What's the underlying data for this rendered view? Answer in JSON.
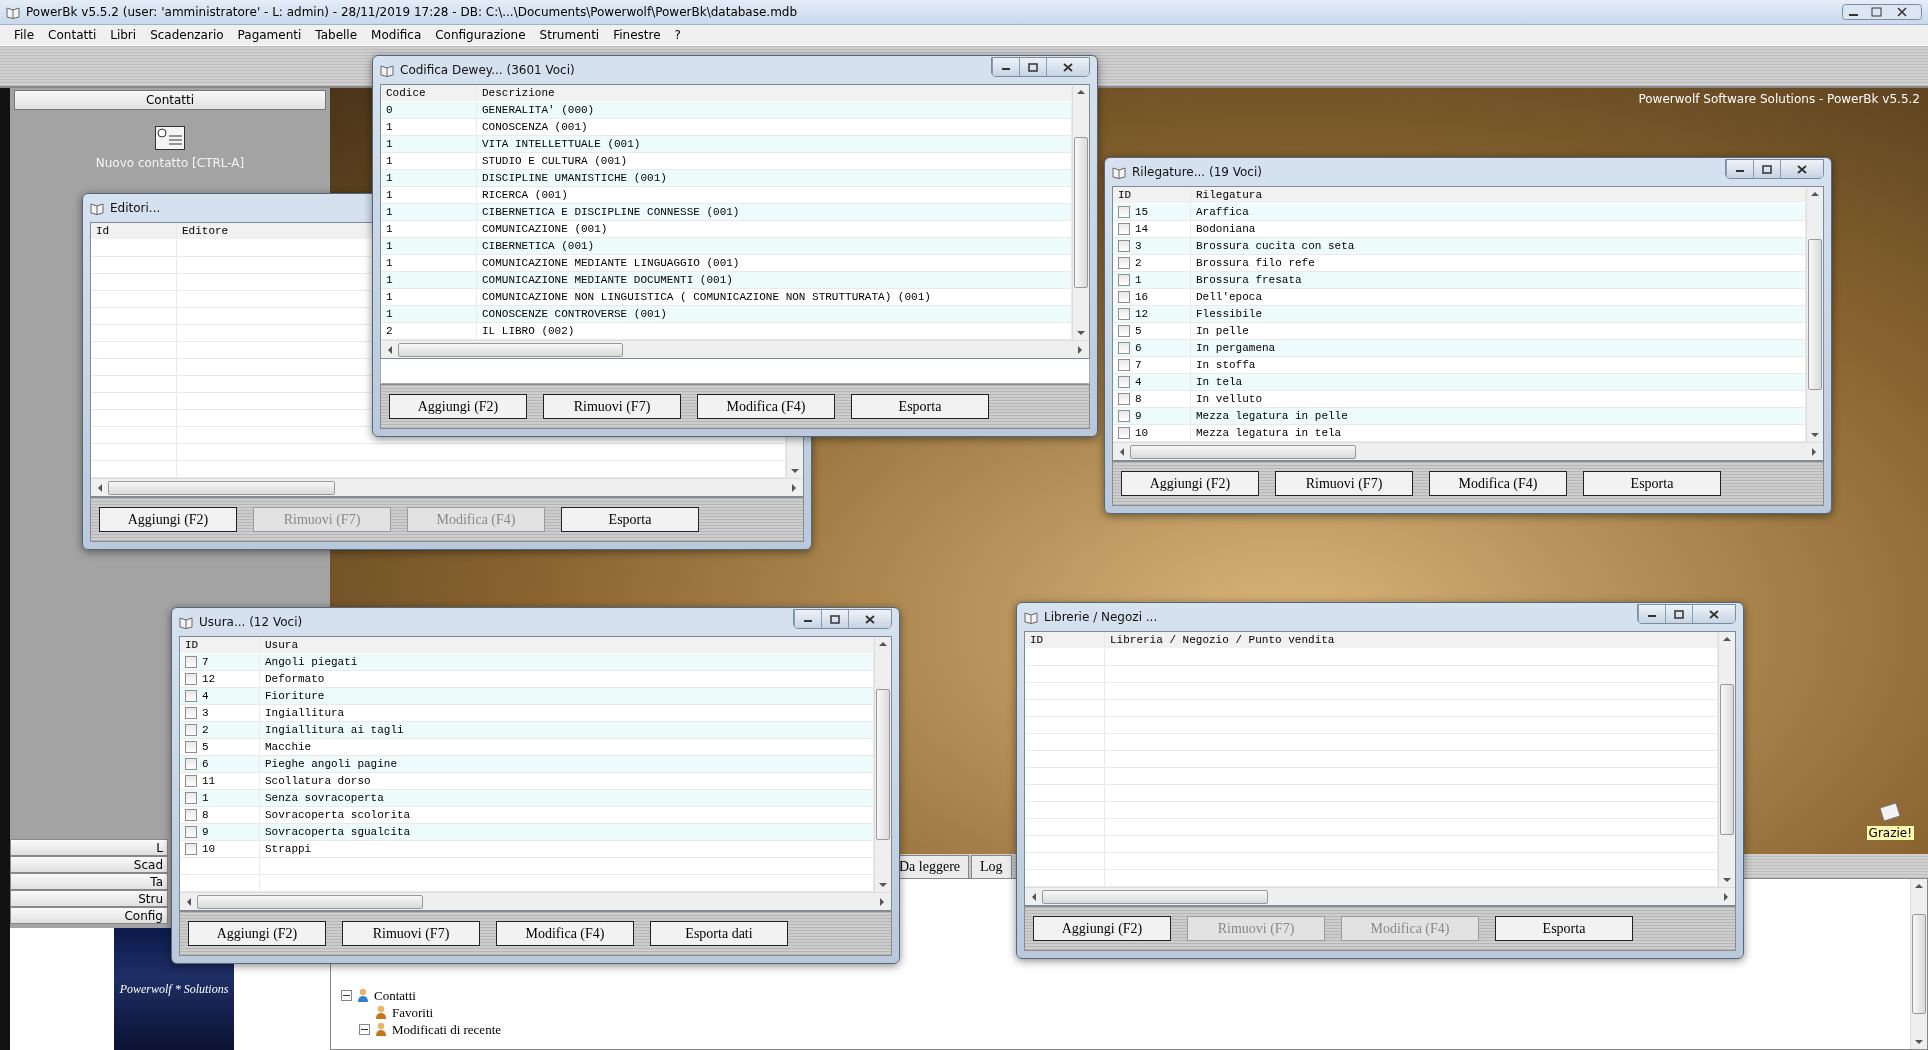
{
  "app_window": {
    "title": "PowerBk v5.5.2  (user: 'amministratore'  - L: admin) - 28/11/2019 17:28 - DB: C:\\...\\Documents\\Powerwolf\\PowerBk\\database.mdb"
  },
  "menu": [
    "File",
    "Contatti",
    "Libri",
    "Scadenzario",
    "Pagamenti",
    "Tabelle",
    "Modifica",
    "Configurazione",
    "Strumenti",
    "Finestre",
    "?"
  ],
  "sidebar": {
    "header": "Contatti",
    "action": "Nuovo contatto [CTRL-A]",
    "buttons": [
      "L",
      "Scad",
      "Ta",
      "Stru",
      "Config"
    ],
    "logo": "Powerwolf * Solutions"
  },
  "background": {
    "caption": "Powerwolf Software Solutions - PowerBk v5.5.2",
    "note": "Grazie!"
  },
  "tabs": [
    {
      "label": "Da leggere",
      "selected": false
    },
    {
      "label": "Log",
      "selected": false
    }
  ],
  "tree": [
    {
      "label": "Contatti",
      "expanded": true,
      "children": [
        {
          "label": "Favoriti"
        },
        {
          "label": "Modificati di recente",
          "expanded": true
        }
      ]
    }
  ],
  "windows": [
    {
      "title": "Editori...",
      "columns": [
        "Id",
        "Editore"
      ],
      "buttons": [
        {
          "label": "Aggiungi (F2)",
          "disabled": false
        },
        {
          "label": "Rimuovi (F7)",
          "disabled": true
        },
        {
          "label": "Modifica (F4)",
          "disabled": true
        },
        {
          "label": "Esporta",
          "disabled": false
        }
      ]
    },
    {
      "title": "Codifica Dewey... (3601 Voci)",
      "columns": [
        "Codice",
        "Descrizione"
      ],
      "rows": [
        {
          "cells": [
            "0",
            "GENERALITA' (000)"
          ]
        },
        {
          "cells": [
            "1",
            "CONOSCENZA (001)"
          ]
        },
        {
          "cells": [
            "1",
            "VITA INTELLETTUALE (001)"
          ]
        },
        {
          "cells": [
            "1",
            "STUDIO E CULTURA (001)"
          ]
        },
        {
          "cells": [
            "1",
            "DISCIPLINE UMANISTICHE (001)"
          ]
        },
        {
          "cells": [
            "1",
            "RICERCA (001)"
          ]
        },
        {
          "cells": [
            "1",
            "CIBERNETICA E DISCIPLINE CONNESSE (001)"
          ]
        },
        {
          "cells": [
            "1",
            "COMUNICAZIONE (001)"
          ]
        },
        {
          "cells": [
            "1",
            "CIBERNETICA (001)"
          ]
        },
        {
          "cells": [
            "1",
            "COMUNICAZIONE MEDIANTE LINGUAGGIO (001)"
          ]
        },
        {
          "cells": [
            "1",
            "COMUNICAZIONE MEDIANTE DOCUMENTI (001)"
          ]
        },
        {
          "cells": [
            "1",
            "COMUNICAZIONE NON LINGUISTICA ( COMUNICAZIONE NON STRUTTURATA) (001)"
          ]
        },
        {
          "cells": [
            "1",
            "CONOSCENZE CONTROVERSE (001)"
          ]
        },
        {
          "cells": [
            "2",
            "IL LIBRO (002)"
          ]
        }
      ],
      "buttons": [
        {
          "label": "Aggiungi (F2)",
          "disabled": false
        },
        {
          "label": "Rimuovi (F7)",
          "disabled": false
        },
        {
          "label": "Modifica (F4)",
          "disabled": false
        },
        {
          "label": "Esporta",
          "disabled": false
        }
      ]
    },
    {
      "title": "Rilegature... (19 Voci)",
      "columns": [
        "ID",
        "Rilegatura"
      ],
      "rows": [
        {
          "cells": [
            "15",
            "Araffica"
          ],
          "checked": false
        },
        {
          "cells": [
            "14",
            "Bodoniana"
          ],
          "checked": false
        },
        {
          "cells": [
            "3",
            "Brossura cucita con seta"
          ],
          "checked": false
        },
        {
          "cells": [
            "2",
            "Brossura filo refe"
          ],
          "checked": false
        },
        {
          "cells": [
            "1",
            "Brossura fresata"
          ],
          "checked": false
        },
        {
          "cells": [
            "16",
            "Dell'epoca"
          ],
          "checked": false
        },
        {
          "cells": [
            "12",
            "Flessibile"
          ],
          "checked": false
        },
        {
          "cells": [
            "5",
            "In pelle"
          ],
          "checked": false
        },
        {
          "cells": [
            "6",
            "In pergamena"
          ],
          "checked": false
        },
        {
          "cells": [
            "7",
            "In stoffa"
          ],
          "checked": false
        },
        {
          "cells": [
            "4",
            "In tela"
          ],
          "checked": false
        },
        {
          "cells": [
            "8",
            "In velluto"
          ],
          "checked": false
        },
        {
          "cells": [
            "9",
            "Mezza legatura in pelle"
          ],
          "checked": false
        },
        {
          "cells": [
            "10",
            "Mezza legatura in tela"
          ],
          "checked": false
        }
      ],
      "buttons": [
        {
          "label": "Aggiungi (F2)",
          "disabled": false
        },
        {
          "label": "Rimuovi (F7)",
          "disabled": false
        },
        {
          "label": "Modifica (F4)",
          "disabled": false
        },
        {
          "label": "Esporta",
          "disabled": false
        }
      ]
    },
    {
      "title": "Usura... (12 Voci)",
      "columns": [
        "ID",
        "Usura"
      ],
      "rows": [
        {
          "cells": [
            "7",
            "Angoli piegati"
          ],
          "checked": false
        },
        {
          "cells": [
            "12",
            "Deformato"
          ],
          "checked": false
        },
        {
          "cells": [
            "4",
            "Fioriture"
          ],
          "checked": false
        },
        {
          "cells": [
            "3",
            "Ingiallitura"
          ],
          "checked": false
        },
        {
          "cells": [
            "2",
            "Ingiallitura ai tagli"
          ],
          "checked": false
        },
        {
          "cells": [
            "5",
            "Macchie"
          ],
          "checked": false
        },
        {
          "cells": [
            "6",
            "Pieghe angoli pagine"
          ],
          "checked": false
        },
        {
          "cells": [
            "11",
            "Scollatura dorso"
          ],
          "checked": false
        },
        {
          "cells": [
            "1",
            "Senza sovracoperta"
          ],
          "checked": false
        },
        {
          "cells": [
            "8",
            "Sovracoperta scolorita"
          ],
          "checked": false
        },
        {
          "cells": [
            "9",
            "Sovracoperta sgualcita"
          ],
          "checked": false
        },
        {
          "cells": [
            "10",
            "Strappi"
          ],
          "checked": false
        }
      ],
      "buttons": [
        {
          "label": "Aggiungi (F2)",
          "disabled": false
        },
        {
          "label": "Rimuovi (F7)",
          "disabled": false
        },
        {
          "label": "Modifica (F4)",
          "disabled": false
        },
        {
          "label": "Esporta dati",
          "disabled": false
        }
      ]
    },
    {
      "title": "Librerie / Negozi ...",
      "columns": [
        "ID",
        "Libreria / Negozio / Punto vendita"
      ],
      "buttons": [
        {
          "label": "Aggiungi (F2)",
          "disabled": false
        },
        {
          "label": "Rimuovi (F7)",
          "disabled": true
        },
        {
          "label": "Modifica (F4)",
          "disabled": true
        },
        {
          "label": "Esporta",
          "disabled": false
        }
      ]
    }
  ]
}
